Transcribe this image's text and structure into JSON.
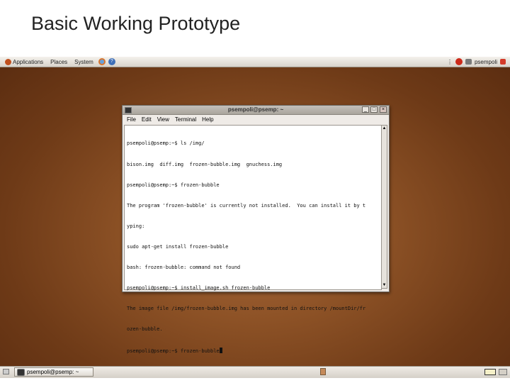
{
  "slide": {
    "title": "Basic Working Prototype"
  },
  "top_panel": {
    "menus": [
      "Applications",
      "Places",
      "System"
    ],
    "user": "psempoli",
    "icons": [
      "browser-icon",
      "help-icon",
      "network-icon",
      "power-icon",
      "monitor-icon",
      "logout-icon"
    ]
  },
  "terminal_window": {
    "title": "psempoli@psemp: ~",
    "menu": [
      "File",
      "Edit",
      "View",
      "Terminal",
      "Help"
    ],
    "lines": [
      "psempoli@psemp:~$ ls /img/",
      "bison.img  diff.img  frozen-bubble.img  gnuchess.img",
      "psempoli@psemp:~$ frozen-bubble",
      "The program 'frozen-bubble' is currently not installed.  You can install it by t",
      "yping:",
      "sudo apt-get install frozen-bubble",
      "bash: frozen-bubble: command not found",
      "psempoli@psemp:~$ install_image.sh frozen-bubble",
      "The image file /img/frozen-bubble.img has been mounted in directory /mountDir/fr",
      "ozen-bubble.",
      "psempoli@psemp:~$ frozen-bubble"
    ]
  },
  "bottom_panel": {
    "task_label": "psempoli@psemp: ~"
  },
  "colors": {
    "desktop": "#8d5226",
    "panel": "#e4e0d9"
  }
}
